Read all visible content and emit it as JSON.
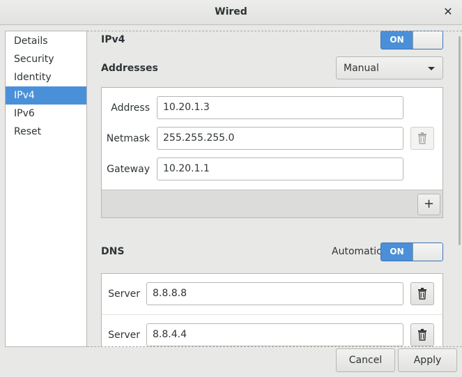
{
  "window": {
    "title": "Wired",
    "close_glyph": "✕"
  },
  "sidebar": {
    "items": [
      {
        "label": "Details"
      },
      {
        "label": "Security"
      },
      {
        "label": "Identity"
      },
      {
        "label": "IPv4"
      },
      {
        "label": "IPv6"
      },
      {
        "label": "Reset"
      }
    ],
    "selected": "IPv4"
  },
  "ipv4": {
    "heading": "IPv4",
    "switch": {
      "state": "ON"
    },
    "addresses": {
      "label": "Addresses",
      "method": "Manual",
      "fields": [
        {
          "label": "Address",
          "value": "10.20.1.3"
        },
        {
          "label": "Netmask",
          "value": "255.255.255.0"
        },
        {
          "label": "Gateway",
          "value": "10.20.1.1"
        }
      ],
      "add_glyph": "+"
    },
    "dns": {
      "label": "DNS",
      "automatic_label": "Automatic",
      "switch": {
        "state": "ON"
      },
      "servers": [
        {
          "label": "Server",
          "value": "8.8.8.8"
        },
        {
          "label": "Server",
          "value": "8.8.4.4"
        }
      ]
    }
  },
  "footer": {
    "cancel_label": "Cancel",
    "apply_label": "Apply"
  },
  "colors": {
    "accent": "#4a90d9",
    "window_bg": "#e8e8e7",
    "panel_footer": "#dcdcda"
  },
  "icons": {
    "delete": "trash-icon",
    "add": "plus-icon",
    "dropdown": "chevron-down-icon",
    "close": "close-icon"
  }
}
